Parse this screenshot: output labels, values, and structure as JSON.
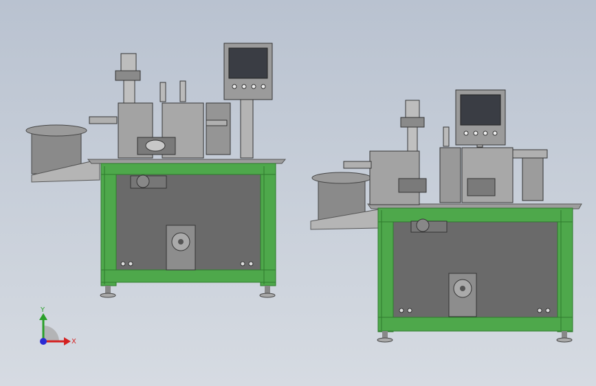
{
  "viewport": {
    "background_top": "#b9c2d0",
    "background_bottom": "#d6dbe2"
  },
  "colors": {
    "frame_green": "#4ea84b",
    "frame_green_dark": "#2e7a2c",
    "machine_gray": "#8f8f8f",
    "machine_dark": "#5b5b5b",
    "screen_dark": "#3a3d44",
    "axis_x": "#d42020",
    "axis_y": "#2aa02a",
    "axis_z": "#2a2ad4"
  },
  "triad": {
    "x_label": "X",
    "y_label": "Y"
  },
  "models": [
    {
      "name": "machine-model-left",
      "view": "front-isometric"
    },
    {
      "name": "machine-model-right",
      "view": "front-isometric"
    }
  ]
}
